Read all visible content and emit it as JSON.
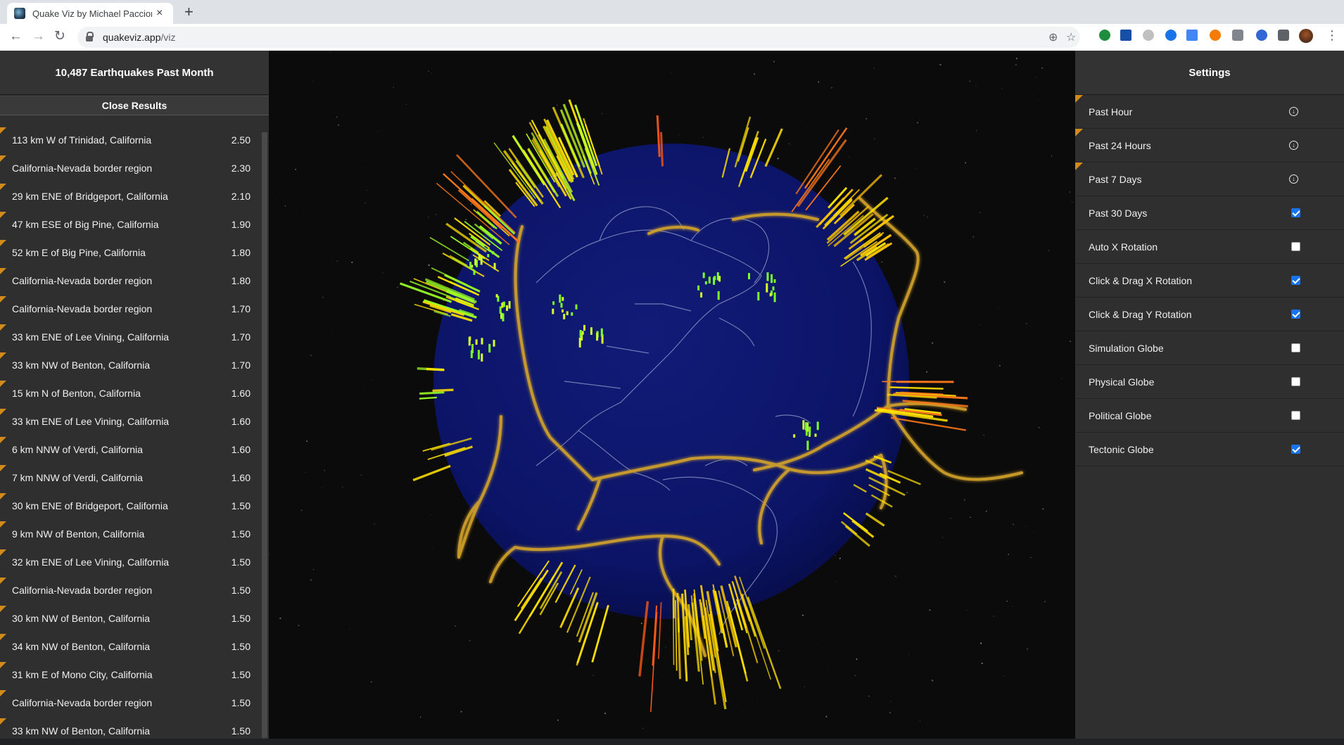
{
  "browser": {
    "tab_title": "Quake Viz by Michael Paccione",
    "tab_close": "×",
    "new_tab": "+",
    "url_host": "quakeviz.app",
    "url_path": "/viz"
  },
  "left_panel": {
    "title": "10,487 Earthquakes Past Month",
    "close_label": "Close Results",
    "results": [
      {
        "place": "113 km W of Trinidad, California",
        "mag": "2.50"
      },
      {
        "place": "California-Nevada border region",
        "mag": "2.30"
      },
      {
        "place": "29 km ENE of Bridgeport, California",
        "mag": "2.10"
      },
      {
        "place": "47 km ESE of Big Pine, California",
        "mag": "1.90"
      },
      {
        "place": "52 km E of Big Pine, California",
        "mag": "1.80"
      },
      {
        "place": "California-Nevada border region",
        "mag": "1.80"
      },
      {
        "place": "California-Nevada border region",
        "mag": "1.70"
      },
      {
        "place": "33 km ENE of Lee Vining, California",
        "mag": "1.70"
      },
      {
        "place": "33 km NW of Benton, California",
        "mag": "1.70"
      },
      {
        "place": "15 km N of Benton, California",
        "mag": "1.60"
      },
      {
        "place": "33 km ENE of Lee Vining, California",
        "mag": "1.60"
      },
      {
        "place": "6 km NNW of Verdi, California",
        "mag": "1.60"
      },
      {
        "place": "7 km NNW of Verdi, California",
        "mag": "1.60"
      },
      {
        "place": "30 km ENE of Bridgeport, California",
        "mag": "1.50"
      },
      {
        "place": "9 km NW of Benton, California",
        "mag": "1.50"
      },
      {
        "place": "32 km ENE of Lee Vining, California",
        "mag": "1.50"
      },
      {
        "place": "California-Nevada border region",
        "mag": "1.50"
      },
      {
        "place": "30 km NW of Benton, California",
        "mag": "1.50"
      },
      {
        "place": "34 km NW of Benton, California",
        "mag": "1.50"
      },
      {
        "place": "31 km E of Mono City, California",
        "mag": "1.50"
      },
      {
        "place": "California-Nevada border region",
        "mag": "1.50"
      },
      {
        "place": "33 km NW of Benton, California",
        "mag": "1.50"
      }
    ]
  },
  "right_panel": {
    "title": "Settings",
    "settings": [
      {
        "label": "Past Hour",
        "control": "download",
        "checked": false,
        "marked": true
      },
      {
        "label": "Past 24 Hours",
        "control": "download",
        "checked": false,
        "marked": true
      },
      {
        "label": "Past 7 Days",
        "control": "download",
        "checked": false,
        "marked": true
      },
      {
        "label": "Past 30 Days",
        "control": "checkbox",
        "checked": true,
        "marked": false
      },
      {
        "label": "Auto X Rotation",
        "control": "checkbox",
        "checked": false,
        "marked": false
      },
      {
        "label": "Click & Drag X Rotation",
        "control": "checkbox",
        "checked": true,
        "marked": false
      },
      {
        "label": "Click & Drag Y Rotation",
        "control": "checkbox",
        "checked": true,
        "marked": false
      },
      {
        "label": "Simulation Globe",
        "control": "checkbox",
        "checked": false,
        "marked": false
      },
      {
        "label": "Physical Globe",
        "control": "checkbox",
        "checked": false,
        "marked": false
      },
      {
        "label": "Political Globe",
        "control": "checkbox",
        "checked": false,
        "marked": false
      },
      {
        "label": "Tectonic Globe",
        "control": "checkbox",
        "checked": true,
        "marked": false
      }
    ]
  },
  "colors": {
    "panel_bg": "#2f2f2f",
    "marker_orange": "#d28a1c",
    "globe_blue": "#0b1466",
    "plate_boundary": "#d6a52a",
    "quake_yellow": "#ffe100",
    "quake_green": "#7cff2a",
    "quake_orange": "#ff7a1a",
    "checkbox_blue": "#1a73e8"
  }
}
